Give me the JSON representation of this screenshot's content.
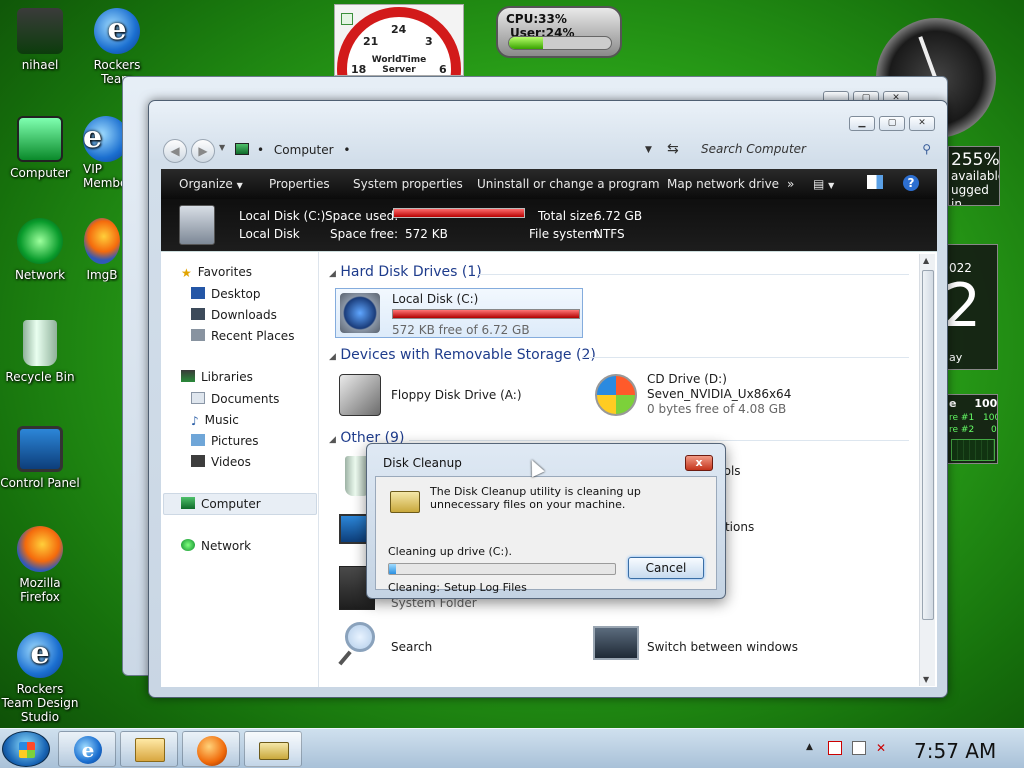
{
  "desktop": {
    "icons": [
      {
        "label": "nihael"
      },
      {
        "label": "Rockers Team"
      },
      {
        "label": "Computer"
      },
      {
        "label": "VIP Membe"
      },
      {
        "label": "Network"
      },
      {
        "label": "ImgB"
      },
      {
        "label": "Recycle Bin"
      },
      {
        "label": "Control Panel"
      },
      {
        "label": "Mozilla Firefox"
      },
      {
        "label": "Rockers Team Design Studio"
      }
    ]
  },
  "gadgets": {
    "clock": {
      "numbers": [
        "24",
        "21",
        "3",
        "18",
        "6"
      ],
      "brand": "WorldTime Server"
    },
    "cpu": {
      "cpu_label": "CPU:33%",
      "user_label": "User:24%",
      "cpu_level": 0.33
    },
    "disk": {
      "percent": "255%",
      "line1": "available",
      "line2": "ugged in"
    },
    "calendar": {
      "year": "022",
      "day": "2",
      "weekday": "ay"
    },
    "meter": {
      "title_prefix": "e",
      "title_value": "100%",
      "row1": "re #1",
      "row1_value": "100%",
      "row2": "re #2",
      "row2_value": "0%"
    }
  },
  "window": {
    "address": {
      "label": "Computer"
    },
    "search": {
      "placeholder": "Search Computer"
    },
    "toolbar": {
      "organize": "Organize",
      "properties": "Properties",
      "system_properties": "System properties",
      "uninstall": "Uninstall or change a program",
      "map_network": "Map network drive",
      "more": "»"
    },
    "details": {
      "name": "Local Disk (C:)",
      "type": "Local Disk",
      "space_used_label": "Space used:",
      "space_used_fraction": 0.999,
      "space_free_label": "Space free:",
      "space_free_value": "572 KB",
      "total_size_label": "Total size:",
      "total_size_value": "6.72 GB",
      "file_system_label": "File system:",
      "file_system_value": "NTFS"
    },
    "nav": {
      "favorites": "Favorites",
      "desktop": "Desktop",
      "downloads": "Downloads",
      "recent_places": "Recent Places",
      "libraries": "Libraries",
      "documents": "Documents",
      "music": "Music",
      "pictures": "Pictures",
      "videos": "Videos",
      "computer": "Computer",
      "network": "Network"
    },
    "groups": {
      "hdd": "Hard Disk Drives (1)",
      "removable": "Devices with Removable Storage (2)",
      "other": "Other (9)"
    },
    "items": {
      "local_disk": {
        "name": "Local Disk (C:)",
        "free": "572 KB free of 6.72 GB",
        "used_fraction": 0.999
      },
      "floppy": {
        "name": "Floppy Disk Drive (A:)"
      },
      "cd": {
        "name": "CD Drive (D:)",
        "label": "Seven_NVIDIA_Ux86x64",
        "free": "0 bytes free of 4.08 GB"
      },
      "tools": {
        "name": "Tools"
      },
      "connections": {
        "name": "ections"
      },
      "system_folder": {
        "name": "System Folder"
      },
      "search": {
        "name": "Search"
      },
      "switch_windows": {
        "name": "Switch between windows"
      }
    }
  },
  "dialog": {
    "title": "Disk Cleanup",
    "message": "The Disk Cleanup utility is cleaning up unnecessary files on your machine.",
    "status_label": "Cleaning up drive  (C:).",
    "progress": 0.03,
    "cleaning_label": "Cleaning:",
    "cleaning_value": "Setup Log Files",
    "cancel": "Cancel",
    "close": "x"
  },
  "taskbar": {
    "time": "7:57 AM"
  }
}
